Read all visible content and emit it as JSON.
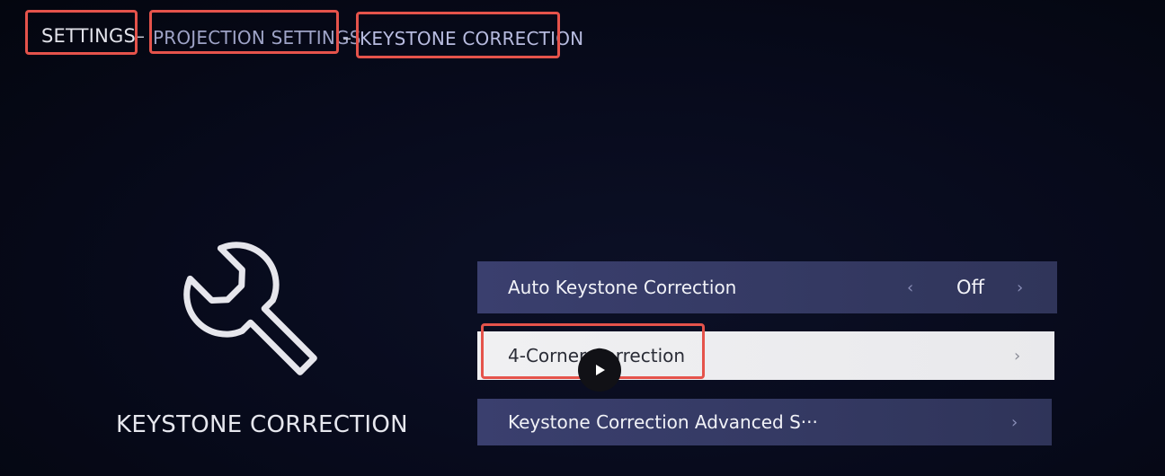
{
  "breadcrumb": {
    "items": [
      "SETTINGS",
      "PROJECTION SETTINGS",
      "KEYSTONE CORRECTION"
    ],
    "separator": "–"
  },
  "left_panel": {
    "icon": "wrench-icon",
    "title": "KEYSTONE CORRECTION"
  },
  "menu": {
    "items": [
      {
        "label": "Auto Keystone Correction",
        "value": "Off",
        "left_arrow": "‹",
        "right_arrow": "›"
      },
      {
        "label": "4-Corner Correction",
        "right_arrow": "›"
      },
      {
        "label": "Keystone Correction Advanced S···",
        "right_arrow": "›"
      }
    ]
  },
  "overlay": {
    "icon": "play-icon"
  },
  "colors": {
    "background": "#070a1b",
    "menu_item": "#363b66",
    "menu_item_selected": "#eeeef0",
    "highlight_box": "#e5534b"
  }
}
